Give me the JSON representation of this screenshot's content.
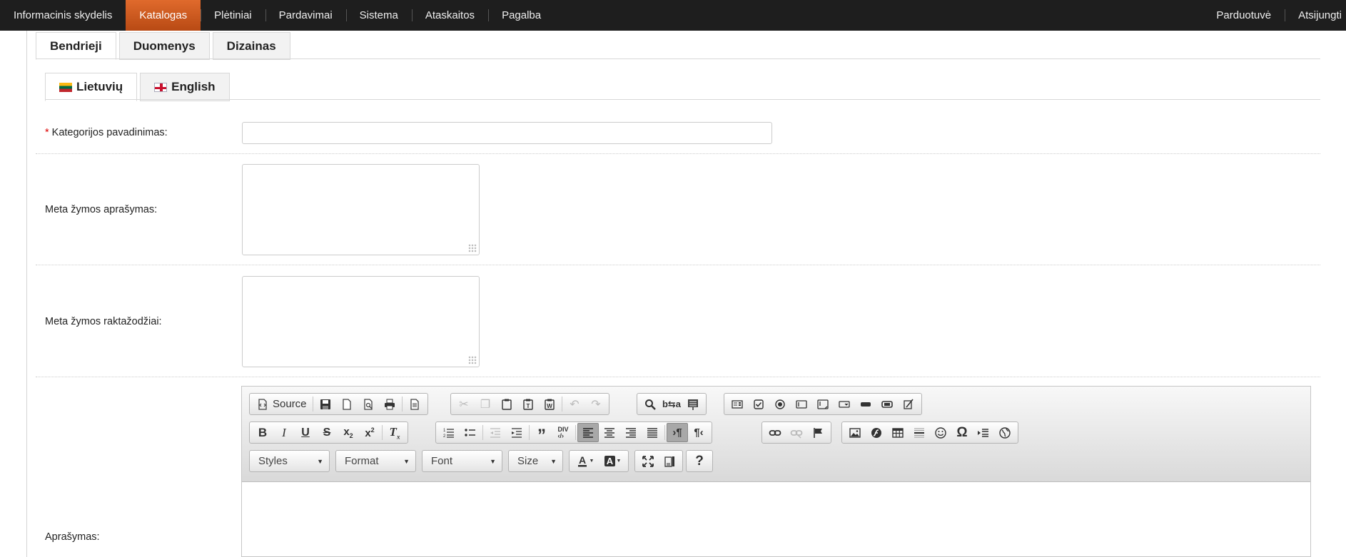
{
  "nav": {
    "items": [
      "Informacinis skydelis",
      "Katalogas",
      "Plėtiniai",
      "Pardavimai",
      "Sistema",
      "Ataskaitos",
      "Pagalba"
    ],
    "active_index": 1,
    "right": [
      "Parduotuvė",
      "Atsijungti"
    ]
  },
  "tabs": [
    "Bendrieji",
    "Duomenys",
    "Dizainas"
  ],
  "active_tab": "Bendrieji",
  "languages": [
    "Lietuvių",
    "English"
  ],
  "active_language": "Lietuvių",
  "form": {
    "required_mark": "*",
    "category_name_label": "Kategorijos pavadinimas:",
    "category_name_value": "",
    "meta_description_label": "Meta žymos aprašymas:",
    "meta_description_value": "",
    "meta_keywords_label": "Meta žymos raktažodžiai:",
    "meta_keywords_value": "",
    "description_label": "Aprašymas:"
  },
  "editor": {
    "source_label": "Source",
    "combos": [
      "Styles",
      "Format",
      "Font",
      "Size"
    ],
    "help": "?"
  },
  "icons": {
    "clipboard_group": [
      "cut-icon",
      "copy-icon",
      "paste-icon",
      "paste-text-icon",
      "paste-word-icon"
    ],
    "undo_group": [
      "undo-icon",
      "redo-icon"
    ],
    "find_group": [
      "find-icon",
      "replace-icon",
      "select-all-icon"
    ],
    "form_group": [
      "form-icon",
      "checkbox-icon",
      "radio-icon",
      "textfield-icon",
      "textarea-icon",
      "select-icon",
      "button-icon",
      "imagebutton-icon",
      "hiddenfield-icon"
    ]
  }
}
